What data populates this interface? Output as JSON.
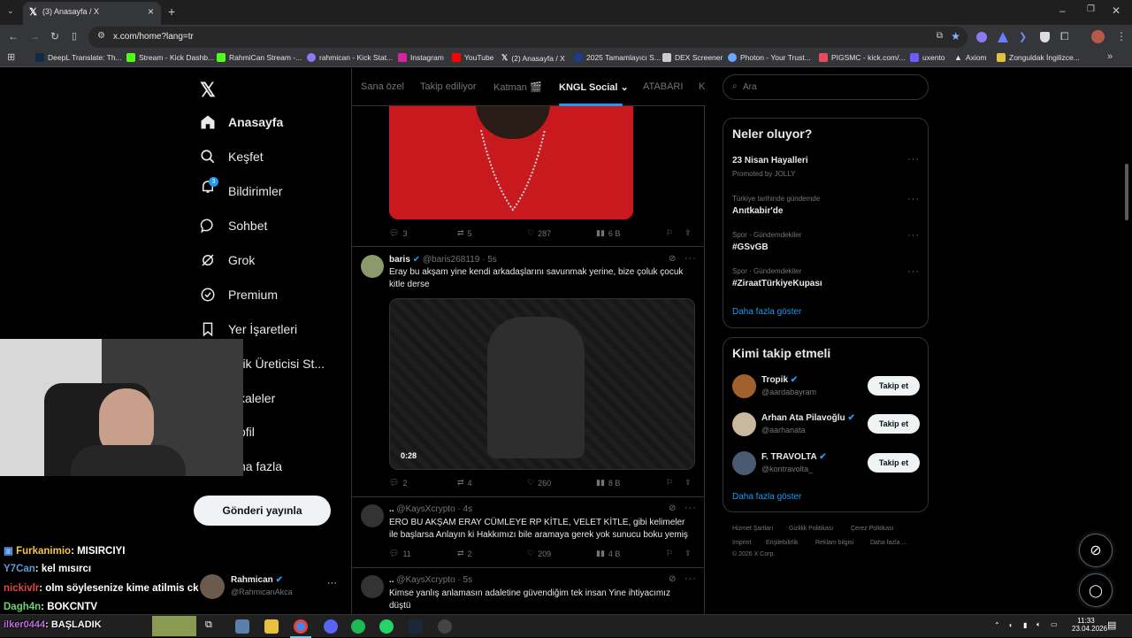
{
  "browser": {
    "tab_title": "(3) Anasayfa / X",
    "url": "x.com/home?lang=tr",
    "bookmarks": [
      "DeepL Translate: Th...",
      "Stream - Kick Dashb...",
      "RahmiCan Stream -...",
      "rahmican - Kick Stat...",
      "Instagram",
      "YouTube",
      "(2) Anasayfa / X",
      "2025 Tamamlayıcı S...",
      "DEX Screener",
      "Photon - Your Trust...",
      "PIGSMC - kick.com/...",
      "uxento",
      "Axiom",
      "Zonguldak İngilizce..."
    ]
  },
  "sidebar": {
    "nav": [
      {
        "label": "Anasayfa",
        "icon": "home-icon"
      },
      {
        "label": "Keşfet",
        "icon": "search-icon"
      },
      {
        "label": "Bildirimler",
        "icon": "bell-icon",
        "badge": "3"
      },
      {
        "label": "Sohbet",
        "icon": "chat-icon"
      },
      {
        "label": "Grok",
        "icon": "grok-icon"
      },
      {
        "label": "Premium",
        "icon": "premium-icon"
      },
      {
        "label": "Yer İşaretleri",
        "icon": "bookmark-icon"
      },
      {
        "label": "erik Üreticisi St..."
      },
      {
        "label": "kaleler"
      },
      {
        "label": "ofil"
      },
      {
        "label": "ha fazla"
      }
    ],
    "post_button": "Gönderi yayınla",
    "account": {
      "name": "Rahmican",
      "handle": "@RahmicanAkca"
    }
  },
  "feed": {
    "tabs": [
      "Sana özel",
      "Takip ediliyor",
      "Katman 🎬",
      "KNGL Social",
      "ATABARI",
      "K"
    ],
    "tweets": [
      {
        "replies": "3",
        "retweets": "5",
        "likes": "287",
        "views": "6 B"
      },
      {
        "name": "baris",
        "handle": "@baris268119",
        "time": "· 5s",
        "text": "Eray bu akşam yine kendi arkadaşlarını savunmak yerine, bize çoluk çocuk kitle derse",
        "video_time": "0:28",
        "replies": "2",
        "retweets": "4",
        "likes": "260",
        "views": "8 B"
      },
      {
        "name": "..",
        "handle": "@KaysXcrypto",
        "time": "· 4s",
        "text": "ERO BU AKŞAM ERAY CÜMLEYE RP KİTLE, VELET KİTLE, gibi kelimeler ile başlarsa Anlayın ki Hakkımızı bile aramaya gerek yok sunucu boku yemiş",
        "replies": "11",
        "retweets": "2",
        "likes": "209",
        "views": "4 B"
      },
      {
        "name": "..",
        "handle": "@KaysXcrypto",
        "time": "· 5s",
        "text": "Kimse yanlış anlamasın adaletine güvendiğim tek insan Yine ihtiyacımız düştü"
      }
    ]
  },
  "right": {
    "search_placeholder": "Ara",
    "trends_title": "Neler oluyor?",
    "trends": [
      {
        "meta": "",
        "name": "23 Nisan Hayalleri",
        "promo": "Promoted by JOLLY"
      },
      {
        "meta": "Türkiye tarihinde gündemde",
        "name": "Anıtkabir'de"
      },
      {
        "meta": "Spor · Gündemdekiler",
        "name": "#GSvGB"
      },
      {
        "meta": "Spor · Gündemdekiler",
        "name": "#ZiraatTürkiyeKupası"
      }
    ],
    "show_more": "Daha fazla göster",
    "wtf_title": "Kimi takip etmeli",
    "wtf": [
      {
        "name": "Tropik",
        "handle": "@aardabayram"
      },
      {
        "name": "Arhan Ata Pilavoğlu",
        "handle": "@aarhanata"
      },
      {
        "name": "F. TRAVOLTA",
        "handle": "@kontravolta_"
      }
    ],
    "follow_label": "Takip et",
    "footer": [
      "Hizmet Şartları",
      "Gizlilik Politikası",
      "Çerez Politikası",
      "Imprint",
      "Erişilebilirlik",
      "Reklam bilgisi",
      "Daha fazla ...",
      "© 2026 X Corp."
    ]
  },
  "chat": [
    {
      "user": "Furkanimio",
      "msg": ": MISIRCIYI",
      "color": "#f6c342"
    },
    {
      "user": "Y7Can",
      "msg": ": kel mısırcı",
      "color": "#5b9bd5"
    },
    {
      "user": "nickivlr",
      "msg": ": olm söylesenize kime atilmis ck",
      "color": "#e04848"
    },
    {
      "user": "Dagh4n",
      "msg": ": BOKCNTV",
      "color": "#69d36e"
    },
    {
      "user": "ilker0444",
      "msg": ": BAŞLADIK",
      "color": "#c070e0"
    }
  ],
  "taskbar": {
    "time": "11:33",
    "date": "23.04.2026"
  }
}
